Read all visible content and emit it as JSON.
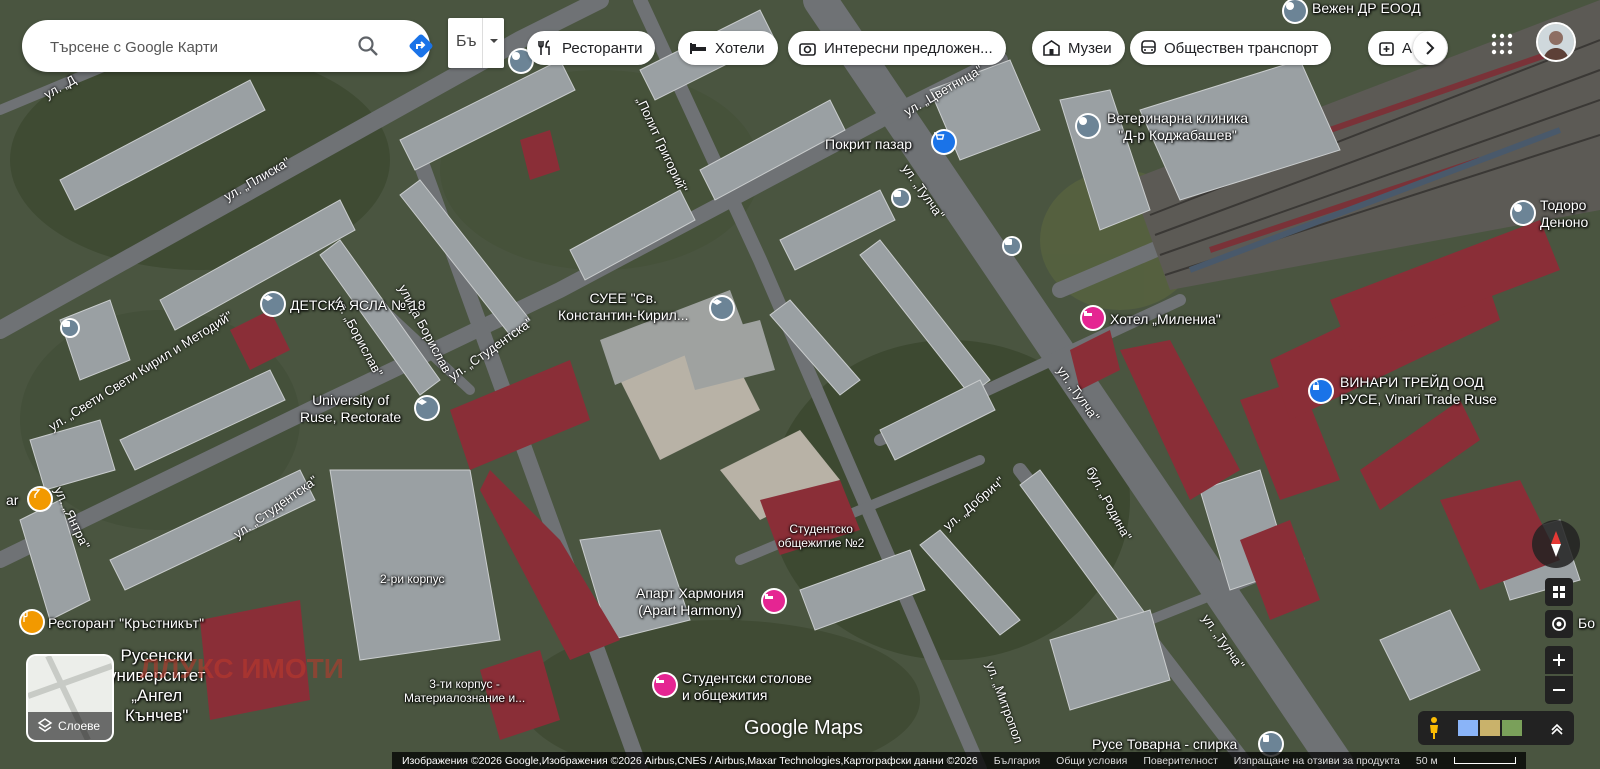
{
  "search": {
    "placeholder": "Търсене с Google Карти"
  },
  "layer_toggle": {
    "label": "Бъ"
  },
  "categories": [
    {
      "label": "Ресторанти",
      "icon": "fork-knife-icon"
    },
    {
      "label": "Хотели",
      "icon": "bed-icon"
    },
    {
      "label": "Интересни предложен...",
      "icon": "camera-icon"
    },
    {
      "label": "Музеи",
      "icon": "museum-icon"
    },
    {
      "label": "Обществен транспорт",
      "icon": "bus-icon"
    },
    {
      "label": "А",
      "icon": "pharmacy-icon"
    }
  ],
  "places": {
    "vejen": "Вежен ДР ЕООД",
    "vet_clinic": "Ветеринарна клиника\n\"Д-р Коджабашев\"",
    "pokrit_pazar": "Покрит пазар",
    "todorov": "Тодоро\nДеноно",
    "detska_yasla": "ДЕТСКА ЯСЛА № 18",
    "suee": "СУЕЕ \"Св.\nКонстантин-Кирил...",
    "hotel_milenia": "Хотел „Милениа\"",
    "vinari": "ВИНАРИ ТРЕЙД ООД\nРУСЕ, Vinari Trade Ruse",
    "university": "University of\nRuse, Rectorate",
    "bar": "ar",
    "studentsko": "Студентско\nобщежитие №2",
    "korpus2": "2-ри корпус",
    "apart": "Апарт Хармония\n(Apart Harmony)",
    "restorant": "Ресторант \"Кръстникът\"",
    "rusenski": "Русенски\nуниверситет\n„Ангел\nКънчев\"",
    "korpus3": "3-ти корпус -\nМатериалознание и...",
    "stolove": "Студентски столове\nи общежития",
    "ruse_tovarna": "Русе Товарна - спирка",
    "bo": "Бо",
    "watermark": "ЛЛУКС ИМОТИ"
  },
  "streets": {
    "pliska": "ул. „Плиска\"",
    "d": "ул. „Д",
    "politgrigoriy": "„Полит Григорий\"",
    "tsvetnitsa": "ул. „Цветница\"",
    "tulcha1": "ул. „Тулча\"",
    "borislav1": "ул. „Борислав\"",
    "borislav2": "улица Борислав",
    "studentska1": "ул. „Студентска\"",
    "kirilmetodii": "ул. „Свети Свети Кирил и Методий\"",
    "yantra": "ул. „Янтра\"",
    "studentska2": "ул. „Студентска\"",
    "tulcha2": "ул. „Тулча\"",
    "rodina": "бул. „Родина\"",
    "dobrich": "ул. „Добрич\"",
    "tulcha3": "ул. „Тулча\"",
    "mitropolit": "ул. „Митропол"
  },
  "layers_button": {
    "label": "Слоеве"
  },
  "google_logo": "Google Maps",
  "attribution": {
    "imagery": "Изображения ©2026 Google,Изображения ©2026 Airbus,CNES / Airbus,Maxar Technologies,Картографски данни ©2026",
    "country": "България",
    "terms": "Общи условия",
    "privacy": "Поверителност",
    "feedback": "Изпращане на отзиви за продукта",
    "scale": "50 м"
  },
  "colors": {
    "accent": "#1a73e8",
    "directions": "#1a73e8",
    "hotel_pin": "#e52592",
    "food_pin": "#f29900",
    "edu_pin": "#5f7d95",
    "shop_pin": "#1a73e8"
  }
}
